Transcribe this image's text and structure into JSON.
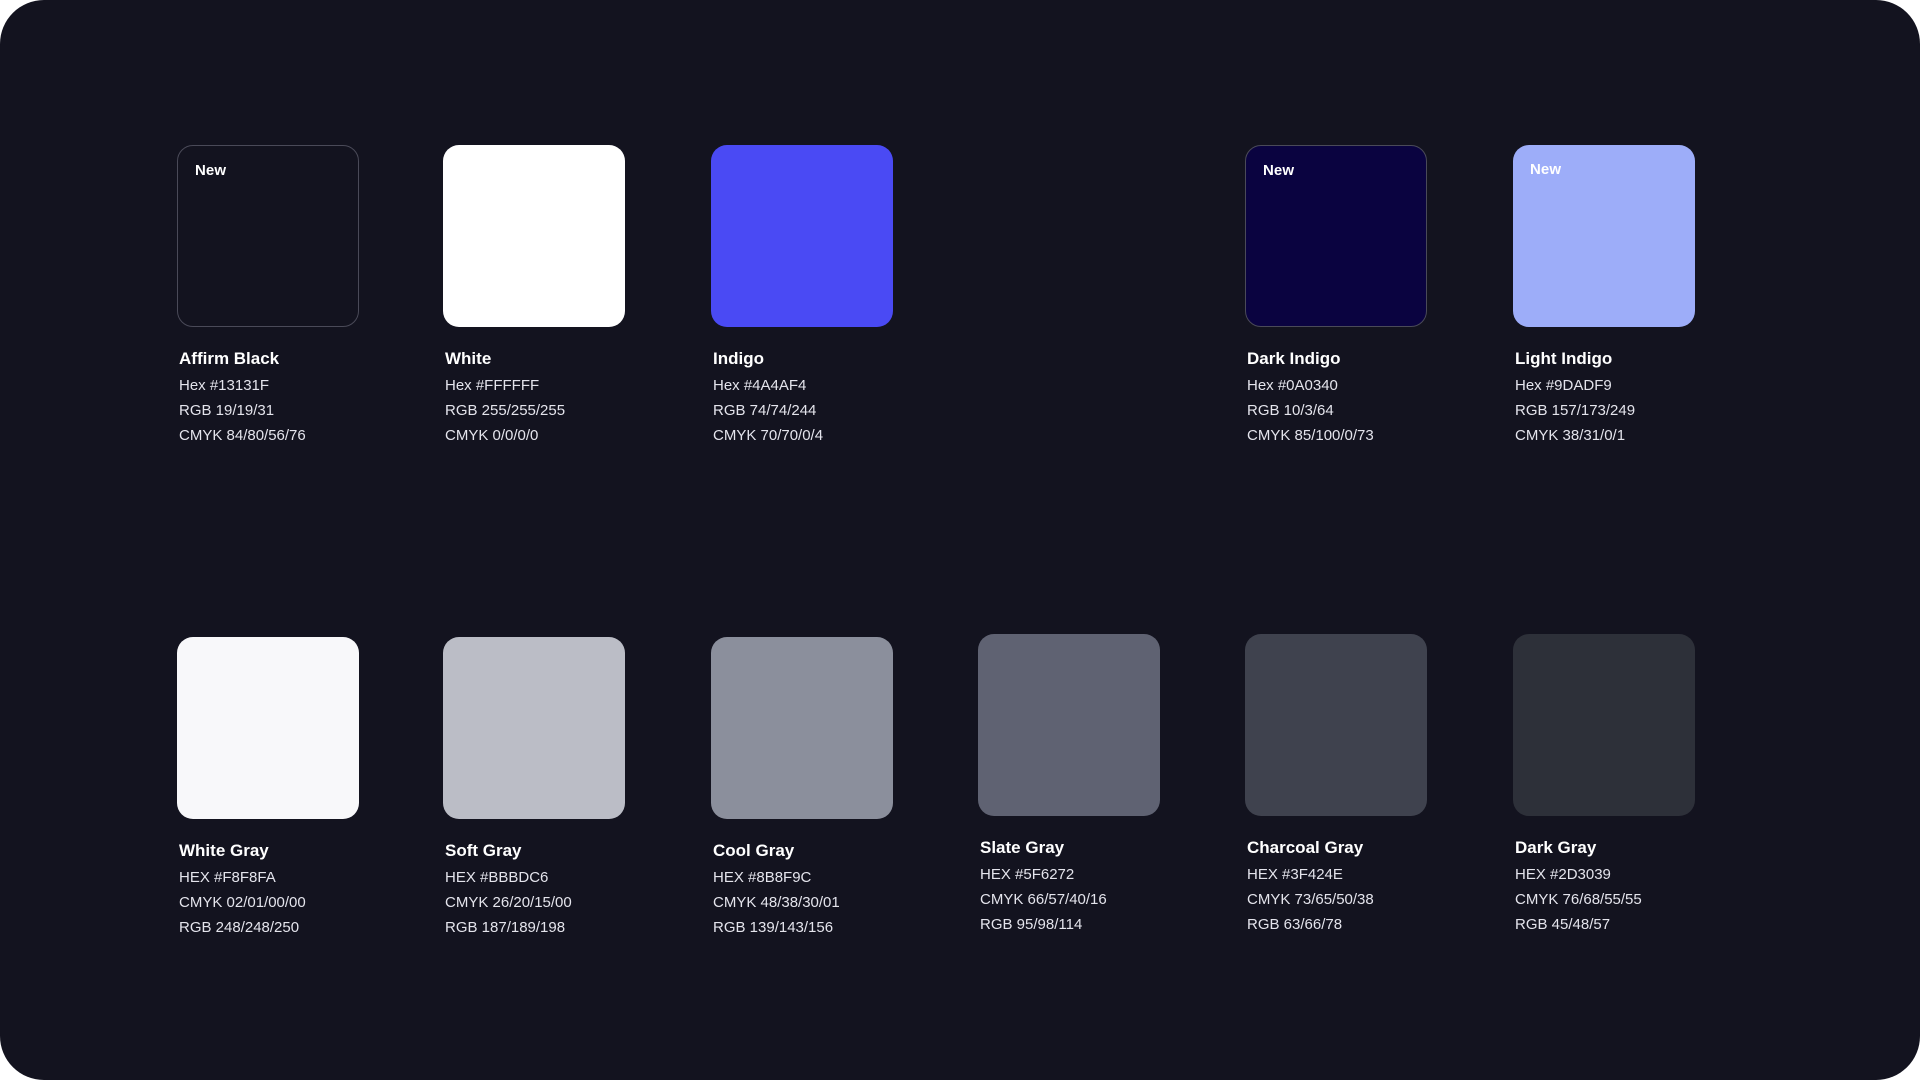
{
  "badge_label": "New",
  "top_row": [
    {
      "name": "Affirm Black",
      "color": "#13131F",
      "badge": true,
      "bordered": true,
      "specs": [
        "Hex #13131F",
        "RGB 19/19/31",
        "CMYK 84/80/56/76"
      ]
    },
    {
      "name": "White",
      "color": "#FFFFFF",
      "badge": false,
      "bordered": false,
      "specs": [
        "Hex #FFFFFF",
        "RGB 255/255/255",
        "CMYK 0/0/0/0"
      ]
    },
    {
      "name": "Indigo",
      "color": "#4A4AF4",
      "badge": false,
      "bordered": false,
      "specs": [
        "Hex #4A4AF4",
        "RGB 74/74/244",
        "CMYK 70/70/0/4"
      ]
    },
    {
      "name": "Dark Indigo",
      "color": "#0A0340",
      "badge": true,
      "bordered": true,
      "specs": [
        "Hex #0A0340",
        "RGB 10/3/64",
        "CMYK 85/100/0/73"
      ]
    },
    {
      "name": "Light Indigo",
      "color": "#9DADF9",
      "badge": true,
      "bordered": false,
      "specs": [
        "Hex #9DADF9",
        "RGB 157/173/249",
        "CMYK 38/31/0/1"
      ]
    }
  ],
  "bottom_row": [
    {
      "name": "White Gray",
      "color": "#F8F8FA",
      "specs": [
        "HEX #F8F8FA",
        "CMYK 02/01/00/00",
        "RGB 248/248/250"
      ]
    },
    {
      "name": "Soft Gray",
      "color": "#BBBDC6",
      "specs": [
        "HEX #BBBDC6",
        "CMYK 26/20/15/00",
        "RGB 187/189/198"
      ]
    },
    {
      "name": "Cool Gray",
      "color": "#8B8F9C",
      "specs": [
        "HEX #8B8F9C",
        "CMYK 48/38/30/01",
        "RGB 139/143/156"
      ]
    },
    {
      "name": "Slate Gray",
      "color": "#5F6272",
      "specs": [
        "HEX #5F6272",
        "CMYK 66/57/40/16",
        "RGB 95/98/114"
      ]
    },
    {
      "name": "Charcoal Gray",
      "color": "#3F424E",
      "specs": [
        "HEX #3F424E",
        "CMYK 73/65/50/38",
        "RGB 63/66/78"
      ]
    },
    {
      "name": "Dark Gray",
      "color": "#2D3039",
      "specs": [
        "HEX #2D3039",
        "CMYK 76/68/55/55",
        "RGB 45/48/57"
      ]
    }
  ]
}
